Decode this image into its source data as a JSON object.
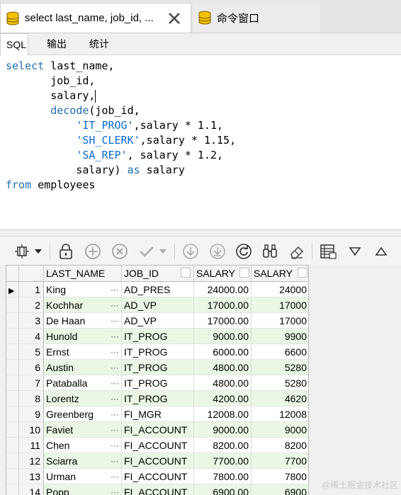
{
  "tabs": [
    {
      "label": "select last_name, job_id, ...",
      "active": true,
      "icon": "database-icon"
    },
    {
      "label": "命令窗口",
      "active": false,
      "icon": "database-icon"
    }
  ],
  "subtabs": [
    "SQL",
    "输出",
    "统计"
  ],
  "editor": {
    "lines": [
      [
        [
          "kw",
          "select"
        ],
        [
          "t",
          " last_name,"
        ]
      ],
      [
        [
          "t",
          "       job_id,"
        ]
      ],
      [
        [
          "t",
          "       salary,"
        ],
        [
          "cursor",
          ""
        ]
      ],
      [
        [
          "t",
          "       "
        ],
        [
          "kw",
          "decode"
        ],
        [
          "t",
          "(job_id,"
        ]
      ],
      [
        [
          "t",
          "           "
        ],
        [
          "str",
          "'IT_PROG'"
        ],
        [
          "t",
          ",salary * 1.1,"
        ]
      ],
      [
        [
          "t",
          "           "
        ],
        [
          "str",
          "'SH_CLERK'"
        ],
        [
          "t",
          ",salary * 1.15,"
        ]
      ],
      [
        [
          "t",
          "           "
        ],
        [
          "str",
          "'SA_REP'"
        ],
        [
          "t",
          ", salary * 1.2,"
        ]
      ],
      [
        [
          "t",
          "           salary) "
        ],
        [
          "kw",
          "as"
        ],
        [
          "t",
          " salary"
        ]
      ],
      [
        [
          "kw",
          "from"
        ],
        [
          "t",
          " employees"
        ]
      ]
    ]
  },
  "toolbar": {
    "buttons": [
      "grid-layout-icon",
      "dropdown-arrow-icon",
      "lock-icon",
      "add-record-icon",
      "delete-record-icon",
      "post-check-icon",
      "post-dropdown-icon",
      "download-arrow-icon",
      "download-all-icon",
      "refresh-icon",
      "binoculars-icon",
      "eraser-icon",
      "table-view-icon",
      "filter-down-icon",
      "filter-up-icon"
    ]
  },
  "grid": {
    "columns": [
      "LAST_NAME",
      "JOB_ID",
      "SALARY",
      "SALARY"
    ],
    "rows": [
      [
        "1",
        "King",
        "AD_PRES",
        "24000.00",
        "24000"
      ],
      [
        "2",
        "Kochhar",
        "AD_VP",
        "17000.00",
        "17000"
      ],
      [
        "3",
        "De Haan",
        "AD_VP",
        "17000.00",
        "17000"
      ],
      [
        "4",
        "Hunold",
        "IT_PROG",
        "9000.00",
        "9900"
      ],
      [
        "5",
        "Ernst",
        "IT_PROG",
        "6000.00",
        "6600"
      ],
      [
        "6",
        "Austin",
        "IT_PROG",
        "4800.00",
        "5280"
      ],
      [
        "7",
        "Pataballa",
        "IT_PROG",
        "4800.00",
        "5280"
      ],
      [
        "8",
        "Lorentz",
        "IT_PROG",
        "4200.00",
        "4620"
      ],
      [
        "9",
        "Greenberg",
        "FI_MGR",
        "12008.00",
        "12008"
      ],
      [
        "10",
        "Faviet",
        "FI_ACCOUNT",
        "9000.00",
        "9000"
      ],
      [
        "11",
        "Chen",
        "FI_ACCOUNT",
        "8200.00",
        "8200"
      ],
      [
        "12",
        "Sciarra",
        "FI_ACCOUNT",
        "7700.00",
        "7700"
      ],
      [
        "13",
        "Urman",
        "FI_ACCOUNT",
        "7800.00",
        "7800"
      ],
      [
        "14",
        "Popp",
        "FI_ACCOUNT",
        "6900.00",
        "6900"
      ]
    ],
    "ellipsis": "···",
    "current_row_indicator": "▶"
  },
  "watermark": "@稀土掘金技术社区",
  "colors": {
    "keyword": "#1f6fb2",
    "string": "#0a6ad6",
    "alt_row": "#e9f7e4"
  }
}
